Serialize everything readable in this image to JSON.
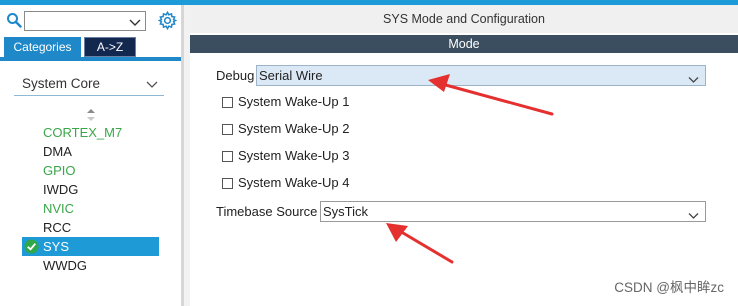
{
  "colors": {
    "accent": "#1e88c9",
    "selected_row": "#1e9ad6",
    "mode_bar": "#3b4e5f",
    "green_text": "#3aa64a",
    "highlight_field": "#dbe9f6",
    "arrow_red": "#e53030"
  },
  "sidebar": {
    "search": {
      "value": "",
      "placeholder": ""
    },
    "tabs": [
      {
        "label": "Categories",
        "active": true
      },
      {
        "label": "A->Z",
        "active": false
      }
    ],
    "category": {
      "label": "System Core",
      "expanded": true
    },
    "items": [
      {
        "label": "CORTEX_M7",
        "color": "green",
        "selected": false
      },
      {
        "label": "DMA",
        "color": "default",
        "selected": false
      },
      {
        "label": "GPIO",
        "color": "green",
        "selected": false
      },
      {
        "label": "IWDG",
        "color": "default",
        "selected": false
      },
      {
        "label": "NVIC",
        "color": "green",
        "selected": false
      },
      {
        "label": "RCC",
        "color": "default",
        "selected": false
      },
      {
        "label": "SYS",
        "color": "default",
        "selected": true
      },
      {
        "label": "WWDG",
        "color": "default",
        "selected": false
      }
    ]
  },
  "main": {
    "title": "SYS Mode and Configuration",
    "section": "Mode",
    "debug": {
      "label": "Debug",
      "value": "Serial Wire"
    },
    "wakeups": [
      {
        "label": "System Wake-Up 1",
        "checked": false
      },
      {
        "label": "System Wake-Up 2",
        "checked": false
      },
      {
        "label": "System Wake-Up 3",
        "checked": false
      },
      {
        "label": "System Wake-Up 4",
        "checked": false
      }
    ],
    "timebase": {
      "label": "Timebase Source",
      "value": "SysTick"
    }
  },
  "watermark": "CSDN @枫中眸zc",
  "icons": {
    "search": "search-icon",
    "settings": "gear-icon",
    "dropdown": "chevron-down-icon",
    "sort": "sort-icon",
    "selected": "check-circle-icon"
  }
}
